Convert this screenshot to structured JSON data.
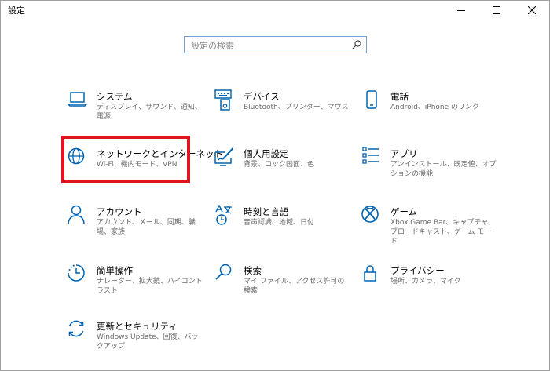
{
  "window": {
    "title": "設定"
  },
  "search": {
    "placeholder": "設定の検索"
  },
  "tiles": [
    {
      "id": "system",
      "title": "システム",
      "desc": "ディスプレイ、サウンド、通知、電源",
      "icon": "laptop-icon"
    },
    {
      "id": "devices",
      "title": "デバイス",
      "desc": "Bluetooth、プリンター、マウス",
      "icon": "keyboard-icon"
    },
    {
      "id": "phone",
      "title": "電話",
      "desc": "Android、iPhone のリンク",
      "icon": "phone-icon"
    },
    {
      "id": "network",
      "title": "ネットワークとインターネット",
      "desc": "Wi-Fi、機内モード、VPN",
      "icon": "globe-icon"
    },
    {
      "id": "personalization",
      "title": "個人用設定",
      "desc": "背景、ロック画面、色",
      "icon": "paint-icon"
    },
    {
      "id": "apps",
      "title": "アプリ",
      "desc": "アンインストール、既定値、オプションの機能",
      "icon": "apps-list-icon"
    },
    {
      "id": "accounts",
      "title": "アカウント",
      "desc": "アカウント、メール、同期、職場、家族",
      "icon": "person-icon"
    },
    {
      "id": "time-language",
      "title": "時刻と言語",
      "desc": "音声認識、地域、日付",
      "icon": "time-language-icon"
    },
    {
      "id": "gaming",
      "title": "ゲーム",
      "desc": "Xbox Game Bar、キャプチャ、ブロードキャスト、ゲーム モード",
      "icon": "xbox-icon"
    },
    {
      "id": "ease-of-access",
      "title": "簡単操作",
      "desc": "ナレーター、拡大鏡、ハイコントラスト",
      "icon": "ease-of-access-icon"
    },
    {
      "id": "search",
      "title": "検索",
      "desc": "マイ ファイル、アクセス許可の検索",
      "icon": "search-icon"
    },
    {
      "id": "privacy",
      "title": "プライバシー",
      "desc": "場所、カメラ、マイク",
      "icon": "lock-icon"
    },
    {
      "id": "update",
      "title": "更新とセキュリティ",
      "desc": "Windows Update、回復、バックアップ",
      "icon": "refresh-icon"
    }
  ],
  "highlighted_tile": "network",
  "colors": {
    "accent": "#0063b1",
    "highlight": "#e0141e",
    "desc_text": "#6a6a6a"
  }
}
